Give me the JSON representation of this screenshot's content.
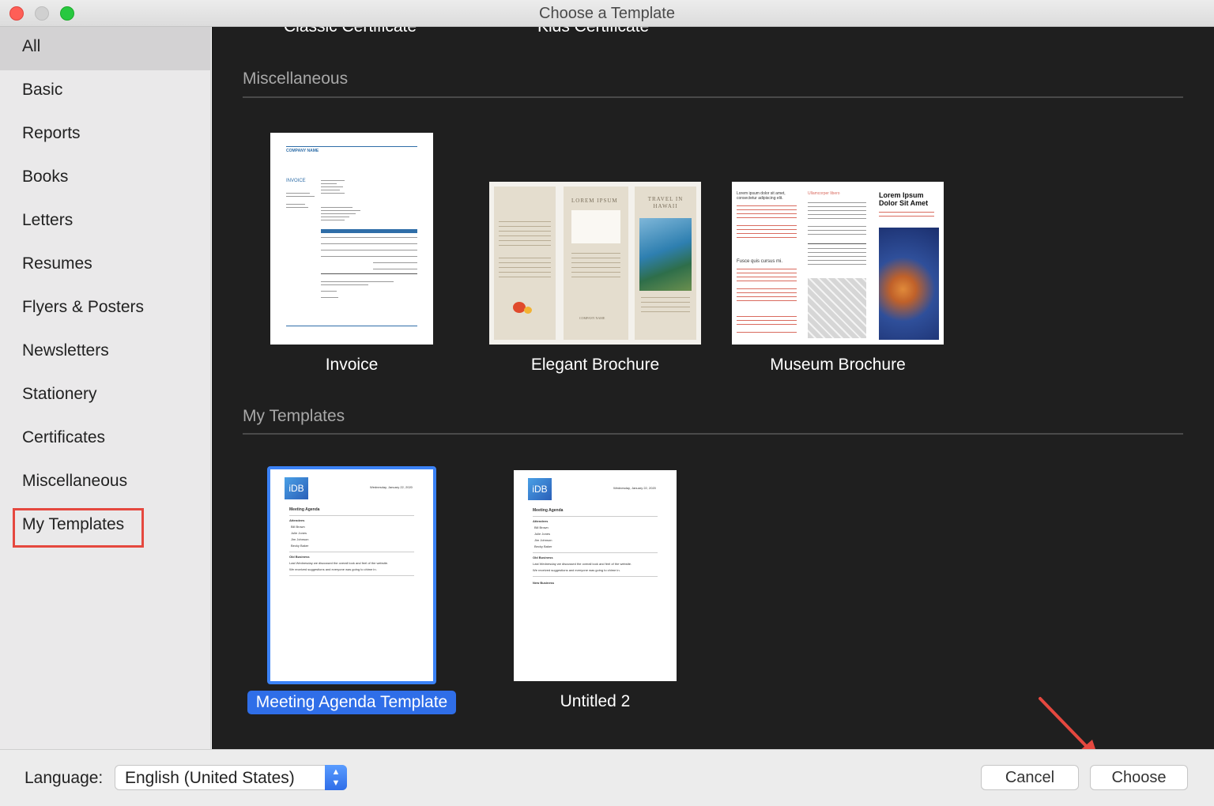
{
  "window": {
    "title": "Choose a Template"
  },
  "sidebar": {
    "items": [
      {
        "label": "All"
      },
      {
        "label": "Basic"
      },
      {
        "label": "Reports"
      },
      {
        "label": "Books"
      },
      {
        "label": "Letters"
      },
      {
        "label": "Resumes"
      },
      {
        "label": "Flyers & Posters"
      },
      {
        "label": "Newsletters"
      },
      {
        "label": "Stationery"
      },
      {
        "label": "Certificates"
      },
      {
        "label": "Miscellaneous"
      },
      {
        "label": "My Templates"
      }
    ],
    "selected": "All"
  },
  "main": {
    "cut_labels": [
      "Classic Certificate",
      "Kids Certificate"
    ],
    "sections": [
      {
        "title": "Miscellaneous",
        "templates": [
          {
            "name": "Invoice"
          },
          {
            "name": "Elegant Brochure"
          },
          {
            "name": "Museum Brochure"
          }
        ]
      },
      {
        "title": "My Templates",
        "templates": [
          {
            "name": "Meeting Agenda Template",
            "selected": true
          },
          {
            "name": "Untitled 2"
          }
        ]
      }
    ],
    "thumb_text": {
      "invoice": {
        "company": "COMPANY NAME",
        "heading": "INVOICE"
      },
      "elegant": {
        "panel2_title": "LOREM IPSUM",
        "panel3_title": "TRAVEL IN HAWAII",
        "company": "COMPANY NAME"
      },
      "museum": {
        "col1_title": "Lorem ipsum dolor sit amet, consectetur adipiscing elit.",
        "col2_title": "Ullamcorper libero",
        "col3_title": "Lorem Ipsum Dolor Sit Amet",
        "col1_sub": "Fusce quis cursus mi."
      },
      "agenda": {
        "logo": "iDB",
        "date": "Wednesday, January 22, 2020",
        "heading": "Meeting Agenda",
        "attendees": "Attendees",
        "people": [
          "Bill Brown",
          "Julie Jones",
          "Jim Johnson",
          "Becky Baker"
        ],
        "old_business": "Old Business",
        "line1": "Last Wednesday we discussed the overall look and feel of the website.",
        "line2": "We received suggestions and everyone was going to chime in.",
        "new_business": "New Business"
      }
    }
  },
  "bottom": {
    "language_label": "Language:",
    "language_value": "English (United States)",
    "cancel_label": "Cancel",
    "choose_label": "Choose"
  },
  "colors": {
    "accent": "#2f6ee8",
    "annotation": "#e5483f",
    "content_bg": "#1f1f1f",
    "sidebar_bg": "#eae9ea"
  }
}
